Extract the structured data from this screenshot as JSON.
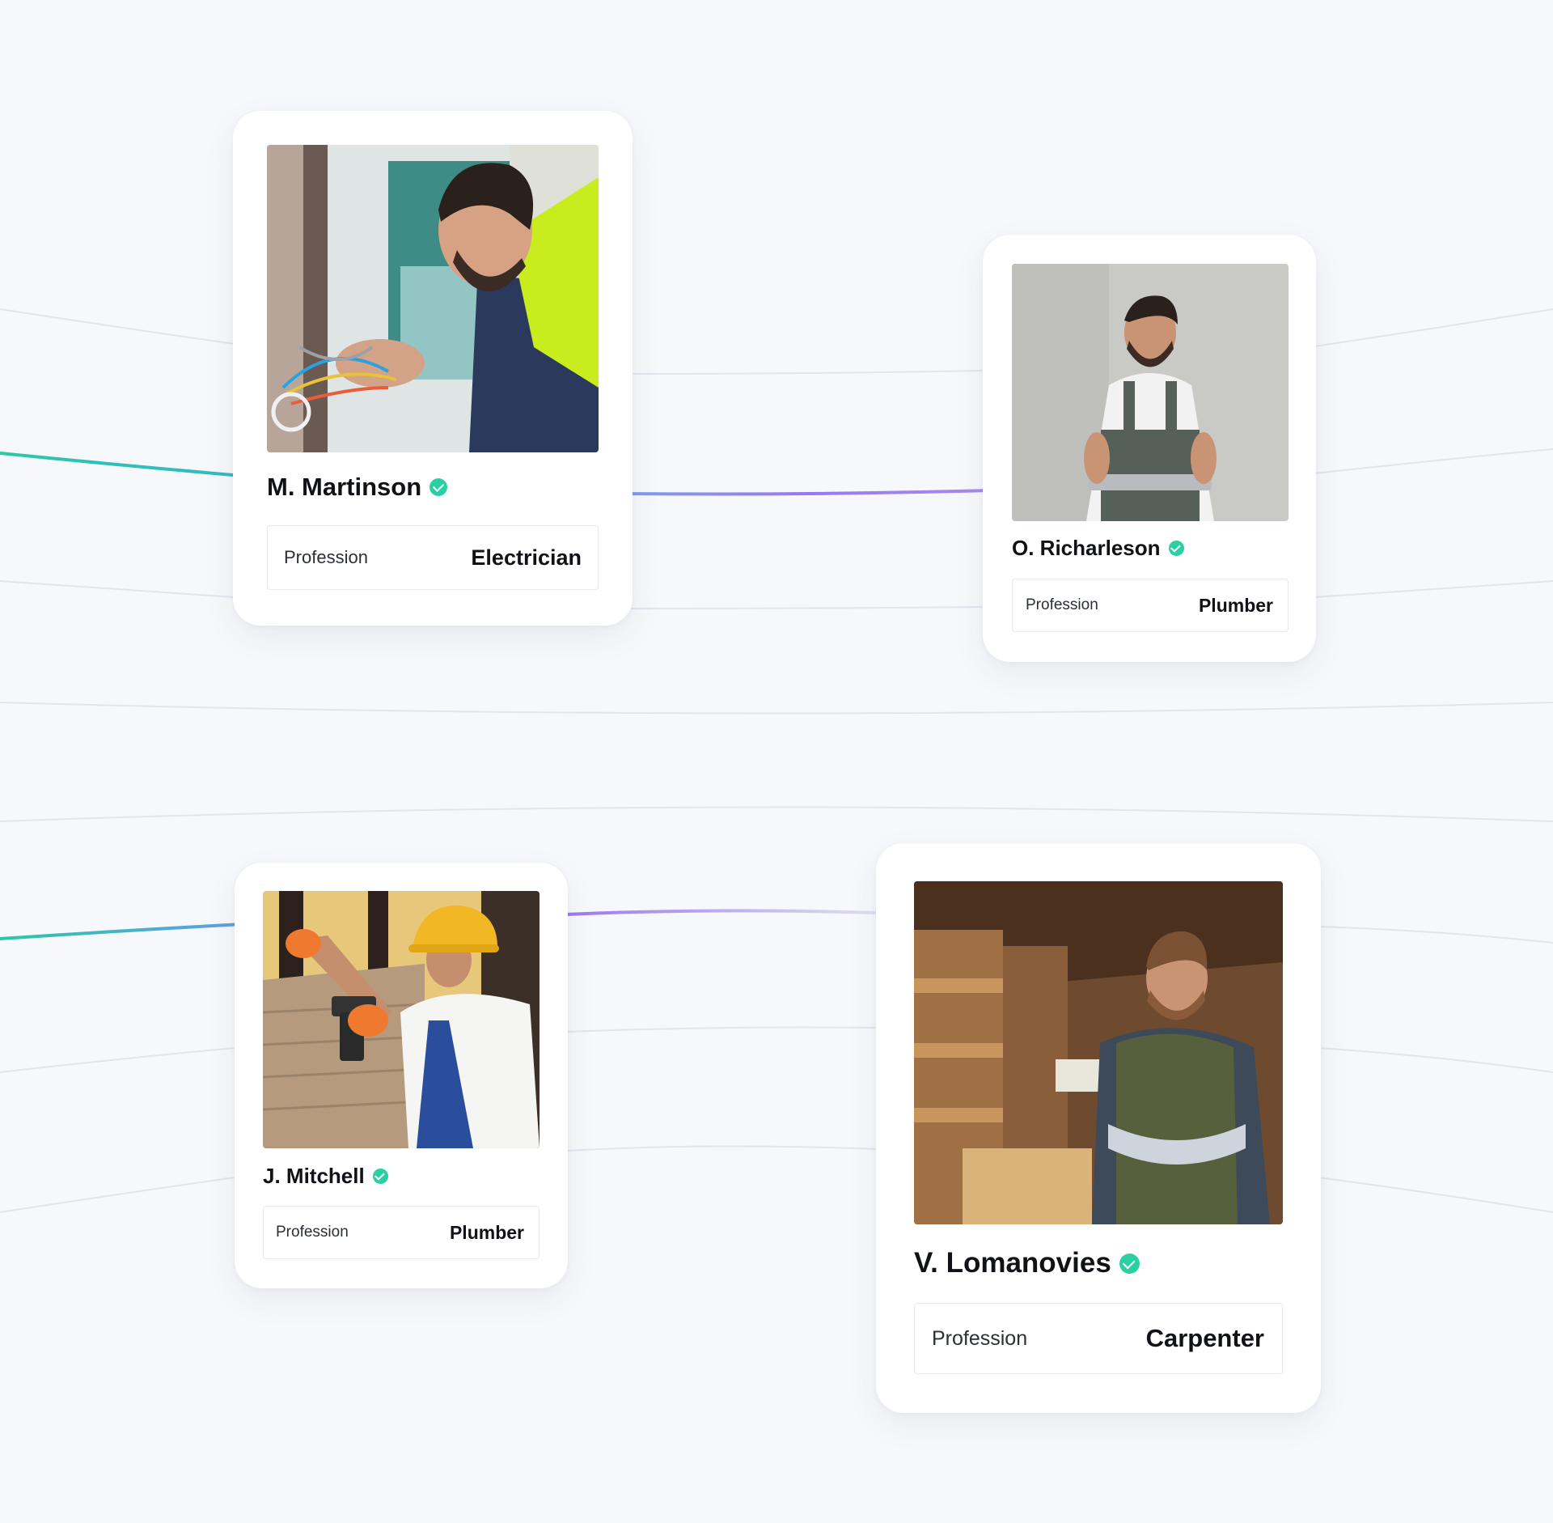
{
  "colors": {
    "background": "#f7f8fb",
    "verified_badge": "#2ccfa2",
    "teal_line": "#2cc7a6",
    "blue_line": "#5f9ee8",
    "purple_line": "#9a78f0"
  },
  "workers": [
    {
      "name": "M. Martinson",
      "verified": true,
      "profession_label": "Profession",
      "profession": "Electrician",
      "photo_icon": "electrician-photo"
    },
    {
      "name": "O. Richarleson",
      "verified": true,
      "profession_label": "Profession",
      "profession": "Plumber",
      "photo_icon": "plumber-photo"
    },
    {
      "name": "J. Mitchell",
      "verified": true,
      "profession_label": "Profession",
      "profession": "Plumber",
      "photo_icon": "builder-photo"
    },
    {
      "name": "V. Lomanovies",
      "verified": true,
      "profession_label": "Profession",
      "profession": "Carpenter",
      "photo_icon": "carpenter-photo"
    }
  ]
}
